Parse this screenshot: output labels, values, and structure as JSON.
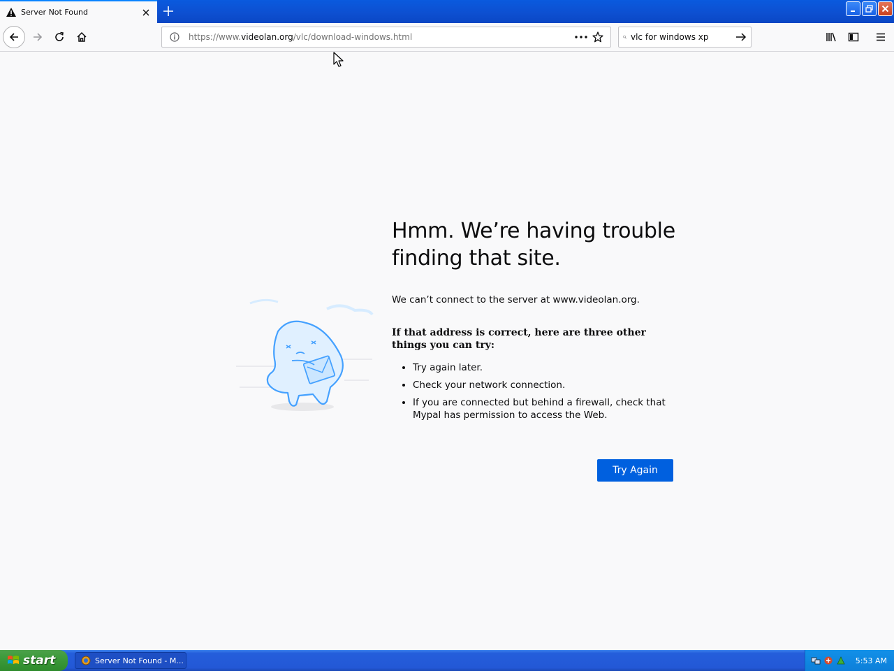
{
  "browser": {
    "tab_title": "Server Not Found",
    "url_prefix": "https://www.",
    "url_host": "videolan.org",
    "url_path": "/vlc/download-windows.html",
    "search_query": "vlc for windows xp"
  },
  "error": {
    "title": "Hmm. We’re having trouble finding that site.",
    "description": "We can’t connect to the server at www.videolan.org.",
    "hint": "If that address is correct, here are three other things you can try:",
    "suggestions": [
      "Try again later.",
      "Check your network connection.",
      "If you are connected but behind a firewall, check that Mypal has permission to access the Web."
    ],
    "button_label": "Try Again"
  },
  "taskbar": {
    "start_label": "start",
    "task_title": "Server Not Found - M...",
    "clock": "5:53 AM"
  },
  "colors": {
    "accent": "#0060df",
    "taskbar_blue": "#245edb",
    "start_green": "#3c9a3a",
    "illustration": "#45a1ff"
  }
}
